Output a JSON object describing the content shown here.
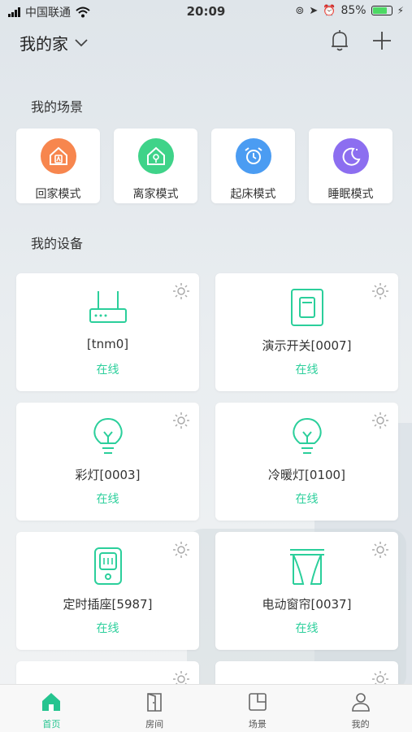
{
  "status_bar": {
    "carrier": "中国联通",
    "time": "20:09",
    "battery": "85%",
    "battery_level": 0.85
  },
  "header": {
    "home_name": "我的家",
    "bell_icon": "bell-icon",
    "add_icon": "plus-icon"
  },
  "scenes": {
    "title": "我的场景",
    "items": [
      {
        "label": "回家模式",
        "icon": "home-person-icon",
        "color": "#f7864e"
      },
      {
        "label": "离家模式",
        "icon": "home-lock-icon",
        "color": "#3fd389"
      },
      {
        "label": "起床模式",
        "icon": "alarm-clock-icon",
        "color": "#4b9cf2"
      },
      {
        "label": "睡眠模式",
        "icon": "moon-icon",
        "color": "#8c6ef0"
      }
    ]
  },
  "devices": {
    "title": "我的设备",
    "items": [
      {
        "name": "[tnm0]",
        "status": "在线",
        "icon": "router-icon"
      },
      {
        "name": "演示开关[0007]",
        "status": "在线",
        "icon": "switch-icon"
      },
      {
        "name": "彩灯[0003]",
        "status": "在线",
        "icon": "bulb-icon"
      },
      {
        "name": "冷暖灯[0100]",
        "status": "在线",
        "icon": "bulb-icon"
      },
      {
        "name": "定时插座[5987]",
        "status": "在线",
        "icon": "socket-icon"
      },
      {
        "name": "电动窗帘[0037]",
        "status": "在线",
        "icon": "curtain-icon"
      }
    ]
  },
  "tabs": [
    {
      "label": "首页",
      "icon": "home-icon",
      "active": true
    },
    {
      "label": "房间",
      "icon": "door-icon",
      "active": false
    },
    {
      "label": "场景",
      "icon": "scene-icon",
      "active": false
    },
    {
      "label": "我的",
      "icon": "person-icon",
      "active": false
    }
  ],
  "colors": {
    "accent": "#25c48f",
    "online": "#2bcf9b"
  }
}
